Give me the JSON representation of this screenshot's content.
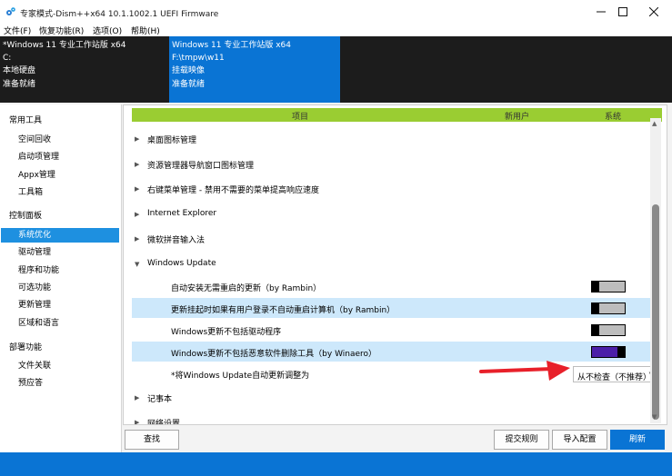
{
  "window": {
    "title": "专家模式-Dism++x64 10.1.1002.1 UEFI Firmware",
    "controls": {
      "minimize": "minimize-icon",
      "maximize": "maximize-icon",
      "close": "close-icon"
    }
  },
  "menu": [
    "文件(F)",
    "恢复功能(R)",
    "选项(O)",
    "帮助(H)"
  ],
  "images": [
    {
      "lines": [
        "*Windows 11 专业工作站版 x64",
        "C:",
        "本地硬盘",
        "准备就绪"
      ],
      "selected": false
    },
    {
      "lines": [
        "Windows 11 专业工作站版 x64",
        "F:\\tmpw\\w11",
        "挂载映像",
        "准备就绪"
      ],
      "selected": true
    }
  ],
  "sidebar": {
    "sections": [
      {
        "title": "常用工具",
        "items": [
          "空间回收",
          "启动项管理",
          "Appx管理",
          "工具箱"
        ]
      },
      {
        "title": "控制面板",
        "items": [
          "系统优化",
          "驱动管理",
          "程序和功能",
          "可选功能",
          "更新管理",
          "区域和语言"
        ]
      },
      {
        "title": "部署功能",
        "items": [
          "文件关联",
          "预应答"
        ]
      }
    ],
    "active": "系统优化"
  },
  "table": {
    "headers": {
      "item": "项目",
      "new_user": "新用户",
      "system": "系统"
    },
    "groups_before": [
      "桌面图标管理",
      "资源管理器导航窗口图标管理",
      "右键菜单管理 - 禁用不需要的菜单提高响应速度",
      "Internet Explorer",
      "微软拼音输入法"
    ],
    "expanded_group": "Windows Update",
    "options": [
      {
        "label": "自动安装无需重启的更新（by Rambin）",
        "toggle": "off"
      },
      {
        "label": "更新挂起时如果有用户登录不自动重启计算机（by Rambin）",
        "toggle": "off"
      },
      {
        "label": "Windows更新不包括驱动程序",
        "toggle": "off"
      },
      {
        "label": "Windows更新不包括恶意软件删除工具（by Winaero）",
        "toggle": "on"
      },
      {
        "label": "*将Windows Update自动更新调整为",
        "select_value": "从不检查（不推荐）"
      }
    ],
    "groups_after": [
      "记事本",
      "网络设置"
    ]
  },
  "buttons": {
    "find": "查找",
    "submit_rules": "提交规则",
    "import_config": "导入配置",
    "refresh": "刷新"
  },
  "colors": {
    "accent": "#0a74d4",
    "header_green": "#9acd32",
    "highlight": "#cde8fb",
    "toggle_on": "#4b1fa8",
    "annotation": "#e8202a"
  }
}
